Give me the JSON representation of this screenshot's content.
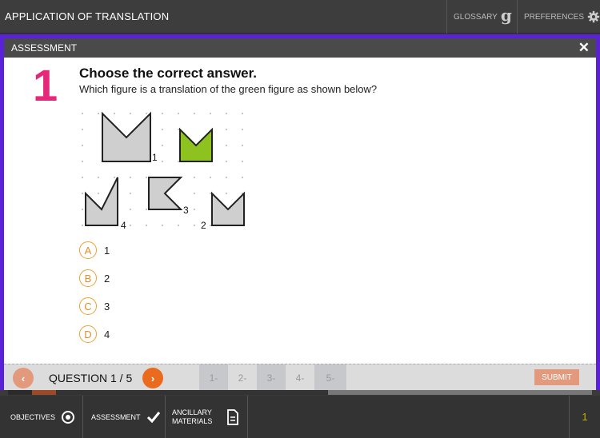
{
  "app": {
    "title": "APPLICATION OF TRANSLATION"
  },
  "topbar": {
    "glossary_label": "GLOSSARY",
    "glossary_glyph": "g",
    "preferences_label": "PREFERENCES"
  },
  "panel": {
    "title": "ASSESSMENT",
    "close_glyph": "✕"
  },
  "question": {
    "number": "1",
    "heading": "Choose the correct answer.",
    "text": "Which figure is a translation of the green figure as shown below?",
    "figure_labels": [
      "1",
      "2",
      "3",
      "4"
    ],
    "options": [
      {
        "letter": "A",
        "text": "1"
      },
      {
        "letter": "B",
        "text": "2"
      },
      {
        "letter": "C",
        "text": "3"
      },
      {
        "letter": "D",
        "text": "4"
      }
    ]
  },
  "qnav": {
    "counter": "QUESTION 1 / 5",
    "prev_glyph": "‹",
    "next_glyph": "›",
    "tabs": [
      "1-",
      "2-",
      "3-",
      "4-",
      "5-"
    ],
    "submit_label": "SUBMIT"
  },
  "bottombar": {
    "objectives_label": "OBJECTIVES",
    "assessment_label": "ASSESSMENT",
    "ancillary_label": "ANCILLARY MATERIALS",
    "page_indicator": "1"
  },
  "colors": {
    "accent_pink": "#e6287a",
    "frame_purple": "#5b21d8",
    "option_orange": "#f0a030",
    "next_orange": "#ea6a1e",
    "figure_green": "#8dc21f",
    "figure_gray": "#cfcfcf"
  },
  "icons": {
    "glossary": "glossary-g-icon",
    "preferences": "gear-icon",
    "close": "close-icon",
    "objectives": "target-icon",
    "assessment": "checkmark-icon",
    "ancillary": "document-icon"
  }
}
